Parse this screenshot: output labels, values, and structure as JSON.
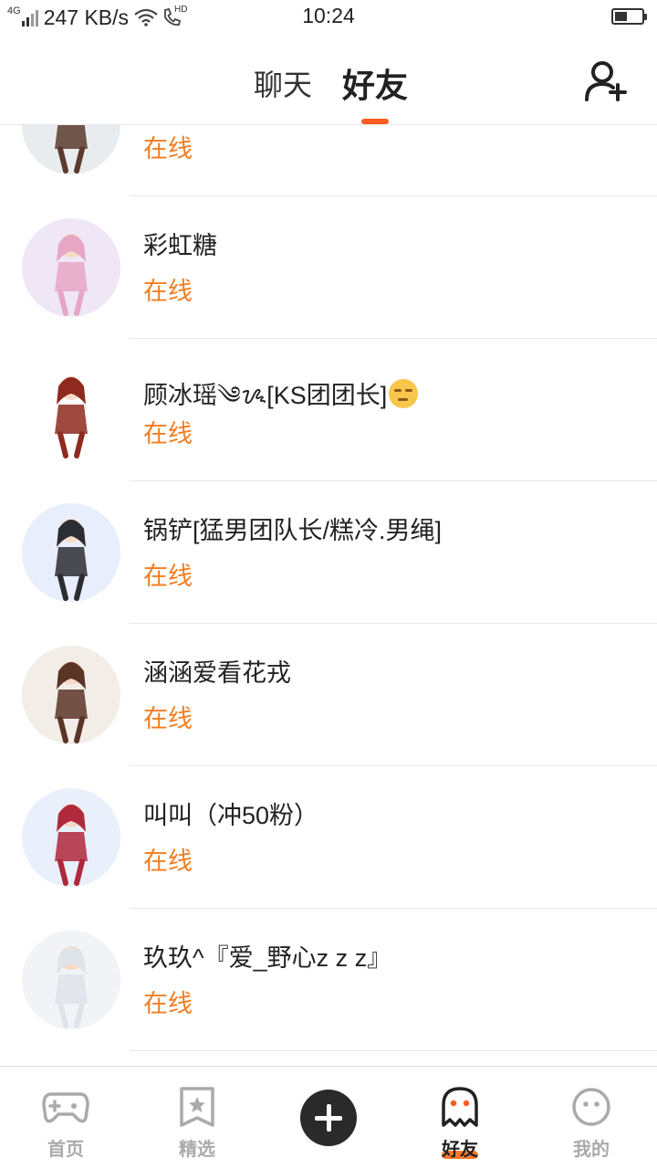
{
  "status_bar": {
    "network": "4G",
    "speed": "247 KB/s",
    "hd": "HD",
    "time": "10:24",
    "battery_level": 0.45
  },
  "header": {
    "tabs": [
      {
        "label": "聊天",
        "active": false
      },
      {
        "label": "好友",
        "active": true
      }
    ],
    "add_friend_icon": "add-user-icon"
  },
  "friends": [
    {
      "name": "",
      "status": "在线",
      "avatar_colors": [
        "#e9ecef",
        "#5a3b2e"
      ]
    },
    {
      "name": "彩虹糖",
      "status": "在线",
      "avatar_colors": [
        "#efe6f6",
        "#e7a6c4"
      ]
    },
    {
      "name": "顾冰瑶༄ᝰ[KS团团长]",
      "status": "在线",
      "emoji": "unamused-face",
      "avatar_colors": [
        "#ffffff",
        "#8e2a1f"
      ]
    },
    {
      "name": "锅铲[猛男团队长/糕冷.男绳]",
      "status": "在线",
      "avatar_colors": [
        "#e8eefb",
        "#2c2c33"
      ]
    },
    {
      "name": "涵涵爱看花戎",
      "status": "在线",
      "avatar_colors": [
        "#f3ede8",
        "#5a3426"
      ]
    },
    {
      "name": "叫叫（冲50粉）",
      "status": "在线",
      "avatar_colors": [
        "#e9f0fb",
        "#b0283b"
      ]
    },
    {
      "name": "玖玖^『爱_野心z z z』",
      "status": "在线",
      "avatar_colors": [
        "#f2f3f6",
        "#dfe3ea"
      ]
    }
  ],
  "bottom_nav": [
    {
      "label": "首页",
      "icon": "gamepad-icon",
      "active": false
    },
    {
      "label": "精选",
      "icon": "star-bookmark-icon",
      "active": false
    },
    {
      "label": "",
      "icon": "plus-icon",
      "active": false
    },
    {
      "label": "好友",
      "icon": "ghost-icon",
      "active": true
    },
    {
      "label": "我的",
      "icon": "smiley-face-icon",
      "active": false
    }
  ]
}
